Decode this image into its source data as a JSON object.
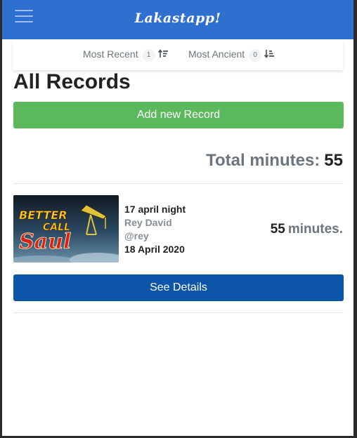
{
  "app": {
    "brand": "Lakastapp!"
  },
  "sort": {
    "most_recent": {
      "label": "Most Recent",
      "count": "1"
    },
    "most_ancient": {
      "label": "Most Ancient",
      "count": "0"
    }
  },
  "page": {
    "title": "All Records",
    "add_button": "Add new Record",
    "total_label": "Total minutes:",
    "total_value": "55"
  },
  "records": [
    {
      "name": "17 april night",
      "user_name": "Rey David",
      "user_handle": "@rey",
      "date": "18 April 2020",
      "minutes": "55",
      "minutes_unit": "minutes.",
      "details_button": "See Details",
      "thumbnail_text": {
        "line1": "BETTER",
        "line2": "CALL",
        "line3": "Saul"
      }
    }
  ],
  "colors": {
    "navbar": "#2e6fcf",
    "add_button": "#5cb85c",
    "details_button": "#0d55a8"
  }
}
